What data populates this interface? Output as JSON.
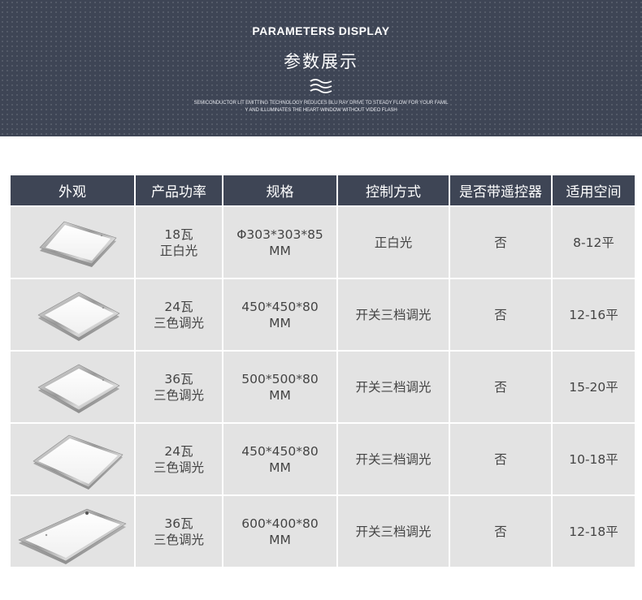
{
  "banner": {
    "title_en": "PARAMETERS DISPLAY",
    "title_cn": "参数展示",
    "icon": "wave-icon",
    "subtitle_line1": "SEMICONDUCTOR LIT EMITTING TECHNOLOGY REDUCES BLU RAY DRIVE TO STEADY FLOW FOR YOUR FAMIL",
    "subtitle_line2": "Y AND ILLUMINATES THE HEART WINDOW WITHOUT VIDEO FLASH"
  },
  "colors": {
    "header_bg": "#3e4555",
    "cell_bg": "#e3e3e3",
    "text": "#444444"
  },
  "table": {
    "headers": [
      "外观",
      "产品功率",
      "规格",
      "控制方式",
      "是否带遥控器",
      "适用空间"
    ],
    "rows": [
      {
        "image": "square-ceiling-lamp-image",
        "power": [
          "18瓦",
          "正白光"
        ],
        "spec": [
          "Φ303*303*85",
          "MM"
        ],
        "control": "正白光",
        "remote": "否",
        "space": "8-12平"
      },
      {
        "image": "square-ceiling-lamp-image",
        "power": [
          "24瓦",
          "三色调光"
        ],
        "spec": [
          "450*450*80",
          "MM"
        ],
        "control": "开关三档调光",
        "remote": "否",
        "space": "12-16平"
      },
      {
        "image": "square-ceiling-lamp-image",
        "power": [
          "36瓦",
          "三色调光"
        ],
        "spec": [
          "500*500*80",
          "MM"
        ],
        "control": "开关三档调光",
        "remote": "否",
        "space": "15-20平"
      },
      {
        "image": "square-ceiling-lamp-image",
        "power": [
          "24瓦",
          "三色调光"
        ],
        "spec": [
          "450*450*80",
          "MM"
        ],
        "control": "开关三档调光",
        "remote": "否",
        "space": "10-18平"
      },
      {
        "image": "rectangular-ceiling-lamp-image",
        "power": [
          "36瓦",
          "三色调光"
        ],
        "spec": [
          "600*400*80",
          "MM"
        ],
        "control": "开关三档调光",
        "remote": "否",
        "space": "12-18平"
      }
    ]
  }
}
